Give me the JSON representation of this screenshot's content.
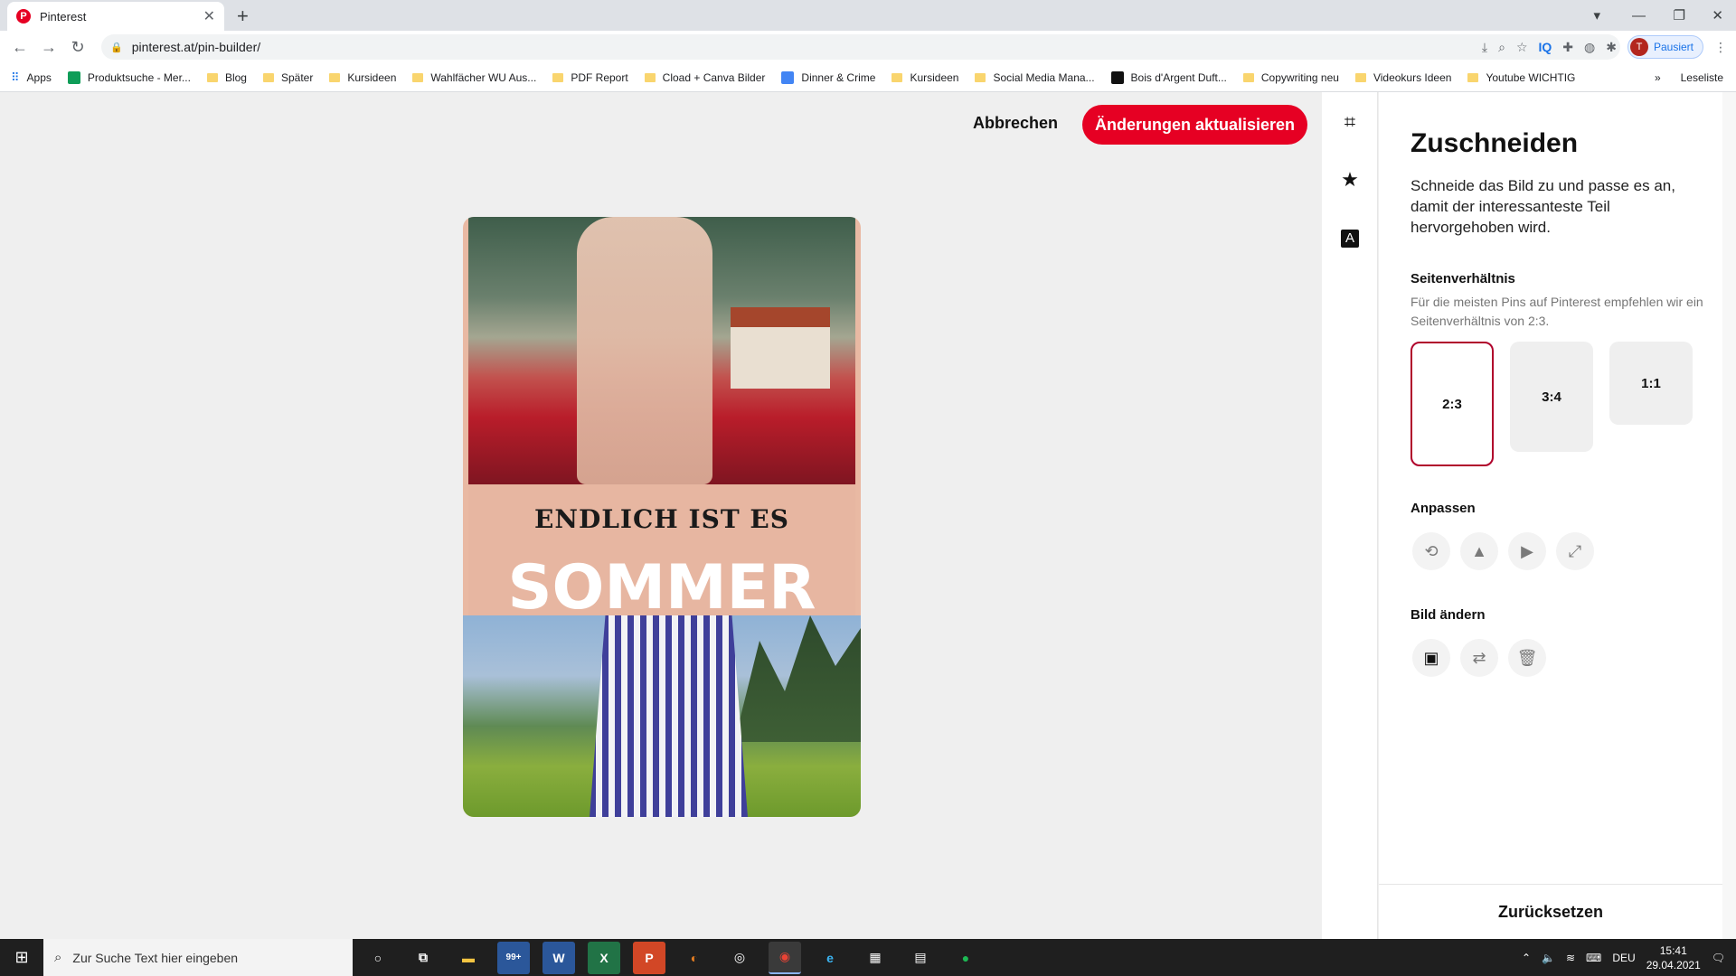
{
  "browser": {
    "tab_title": "Pinterest",
    "favicon": "P",
    "new_tab": "+",
    "url": "pinterest.at/pin-builder/",
    "profile_initial": "T",
    "profile_label": "Pausiert",
    "bookmarks": [
      {
        "label": "Apps",
        "type": "apps"
      },
      {
        "label": "Produktsuche - Mer...",
        "type": "green"
      },
      {
        "label": "Blog",
        "type": "folder"
      },
      {
        "label": "Später",
        "type": "folder"
      },
      {
        "label": "Kursideen",
        "type": "folder"
      },
      {
        "label": "Wahlfächer WU Aus...",
        "type": "folder"
      },
      {
        "label": "PDF Report",
        "type": "folder"
      },
      {
        "label": "Cload + Canva Bilder",
        "type": "folder"
      },
      {
        "label": "Dinner & Crime",
        "type": "blue"
      },
      {
        "label": "Kursideen",
        "type": "folder"
      },
      {
        "label": "Social Media Mana...",
        "type": "folder"
      },
      {
        "label": "Bois d'Argent Duft...",
        "type": "dark"
      },
      {
        "label": "Copywriting neu",
        "type": "folder"
      },
      {
        "label": "Videokurs Ideen",
        "type": "folder"
      },
      {
        "label": "Youtube WICHTIG",
        "type": "folder"
      }
    ],
    "more_bookmarks": "»",
    "reading_list": "Leseliste"
  },
  "editor": {
    "cancel_label": "Abbrechen",
    "update_label": "Änderungen aktualisieren",
    "pin_text_sub": "ENDLICH IST ES",
    "pin_text_main": "SOMMER"
  },
  "panel": {
    "title": "Zuschneiden",
    "description": "Schneide das Bild zu und passe es an, damit der interessanteste Teil hervorgehoben wird.",
    "aspect_heading": "Seitenverhältnis",
    "aspect_hint": "Für die meisten Pins auf Pinterest empfehlen wir ein Seitenverhältnis von 2:3.",
    "ratios": [
      {
        "label": "2:3",
        "selected": true
      },
      {
        "label": "3:4",
        "selected": false
      },
      {
        "label": "1:1",
        "selected": false
      }
    ],
    "adjust_heading": "Anpassen",
    "change_heading": "Bild ändern",
    "reset_label": "Zurücksetzen"
  },
  "taskbar": {
    "search_placeholder": "Zur Suche Text hier eingeben",
    "mail_badge": "99+",
    "language": "DEU",
    "time": "15:41",
    "date": "29.04.2021"
  },
  "colors": {
    "accent": "#e60023",
    "selected_border": "#b0002b"
  }
}
